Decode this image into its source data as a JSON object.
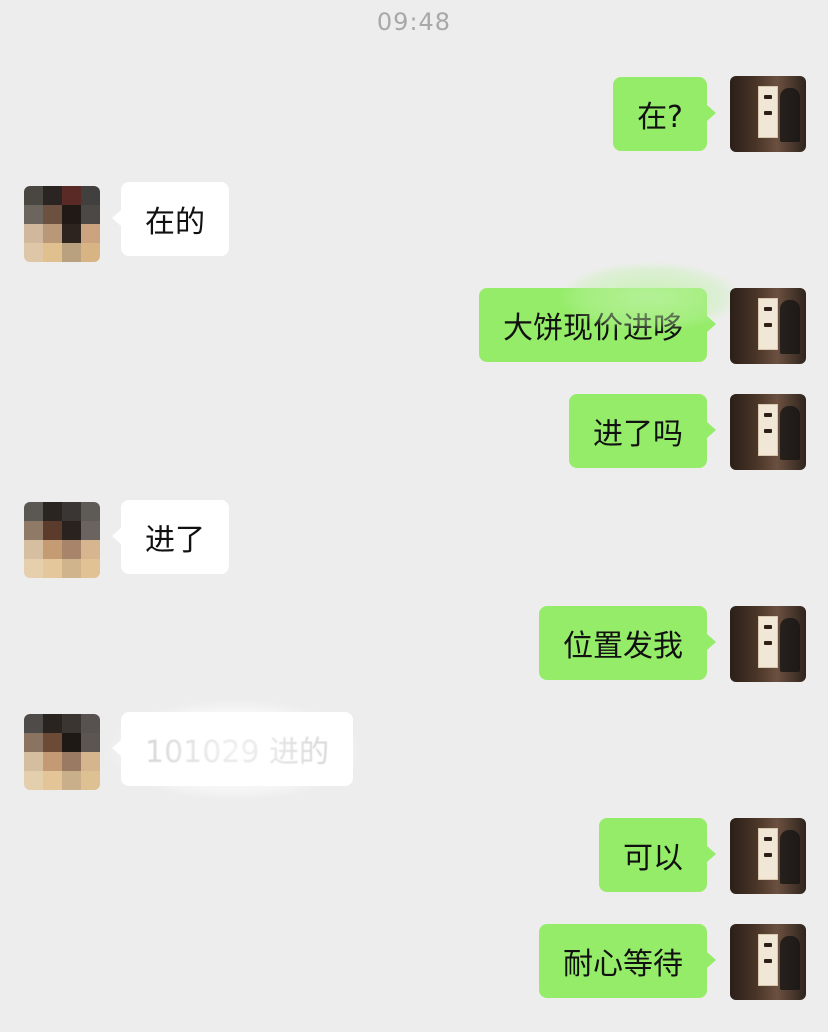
{
  "chat": {
    "timestamp": "09:48",
    "messages": [
      {
        "side": "right",
        "text": "在?"
      },
      {
        "side": "left",
        "text": "在的"
      },
      {
        "side": "right",
        "text": "大饼现价进哆"
      },
      {
        "side": "right",
        "text": "进了吗"
      },
      {
        "side": "left",
        "text": "进了"
      },
      {
        "side": "right",
        "text": "位置发我"
      },
      {
        "side": "left",
        "text": "101029 进的"
      },
      {
        "side": "right",
        "text": "可以"
      },
      {
        "side": "right",
        "text": "耐心等待"
      }
    ]
  },
  "colors": {
    "background": "#ededed",
    "outgoing_bubble": "#95ec69",
    "incoming_bubble": "#ffffff",
    "timestamp_text": "#a8a8a8"
  },
  "icons": {
    "self_avatar": "profile-photo-icon",
    "contact_avatar": "pixelated-profile-icon"
  }
}
